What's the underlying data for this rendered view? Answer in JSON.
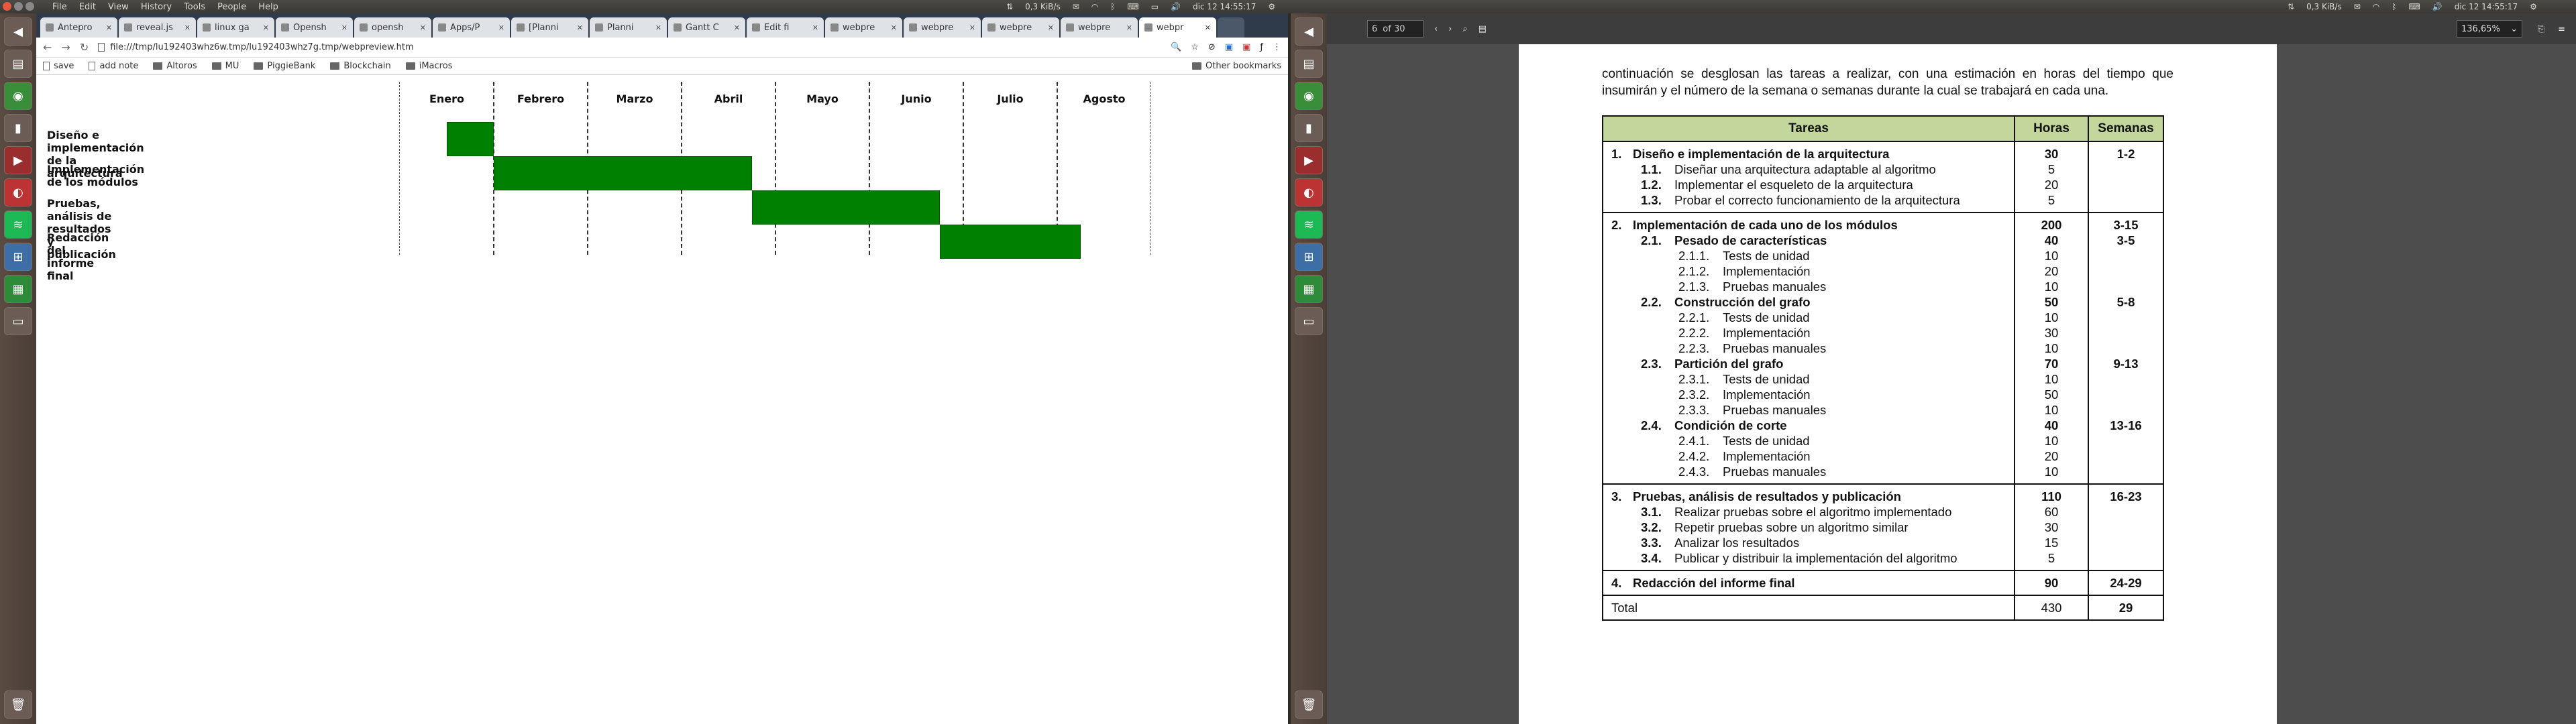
{
  "topbar": {
    "menus": [
      "File",
      "Edit",
      "View",
      "History",
      "Tools",
      "People",
      "Help"
    ],
    "left_status": {
      "network": "0,3 KiB/s",
      "time": "dic 12    14:55:17"
    },
    "right_status": {
      "network": "0,3 KiB/s",
      "time": "dic 12    14:55:17"
    }
  },
  "browser": {
    "tabs": [
      "Antepro",
      "reveal.js",
      "linux ga",
      "Opensh",
      "opensh",
      "Apps/P",
      "[Planni",
      "Planni",
      "Gantt C",
      "Edit fi",
      "webpre",
      "webpre",
      "webpre",
      "webpre",
      "webpr"
    ],
    "url": "file:///tmp/lu192403whz6w.tmp/lu192403whz7g.tmp/webpreview.htm",
    "bookmarks": [
      "save",
      "add note",
      "Altoros",
      "MU",
      "PiggieBank",
      "Blockchain",
      "iMacros"
    ],
    "other_bookmarks": "Other bookmarks"
  },
  "gantt": {
    "months": [
      "Enero",
      "Febrero",
      "Marzo",
      "Abril",
      "Mayo",
      "Junio",
      "Julio",
      "Agosto"
    ],
    "rows": [
      {
        "label": "Diseño e implementación de la arquitectura",
        "start": 0.5,
        "end": 1.0
      },
      {
        "label": "Implementación de los módulos",
        "start": 1.0,
        "end": 3.75
      },
      {
        "label": "Pruebas, análisis de resultados y publicación",
        "start": 3.75,
        "end": 5.75
      },
      {
        "label": "Redacción del informe final",
        "start": 5.75,
        "end": 7.25
      }
    ],
    "bar_color": "#008000"
  },
  "pdf": {
    "page_input": "6",
    "page_total": "of 30",
    "zoom": "136,65%",
    "intro": "continuación se desglosan las tareas a realizar, con una estimación en horas del tiempo que insumirán y el número de la semana o semanas durante la cual se trabajará en cada una.",
    "headers": {
      "tasks": "Tareas",
      "hours": "Horas",
      "weeks": "Semanas"
    },
    "header_color": "#c3d69b",
    "blocks": [
      {
        "lines": [
          {
            "lvl": 0,
            "num": "1.",
            "text": "Diseño e implementación de la arquitectura",
            "hours": "30",
            "weeks": "1-2",
            "bold": true
          },
          {
            "lvl": 1,
            "num": "1.1.",
            "text": "Diseñar una arquitectura adaptable al algoritmo",
            "hours": "5",
            "weeks": ""
          },
          {
            "lvl": 1,
            "num": "1.2.",
            "text": "Implementar el esqueleto de la arquitectura",
            "hours": "20",
            "weeks": ""
          },
          {
            "lvl": 1,
            "num": "1.3.",
            "text": "Probar el correcto funcionamiento de la arquitectura",
            "hours": "5",
            "weeks": ""
          }
        ]
      },
      {
        "lines": [
          {
            "lvl": 0,
            "num": "2.",
            "text": "Implementación de cada uno de los módulos",
            "hours": "200",
            "weeks": "3-15",
            "bold": true
          },
          {
            "lvl": 1,
            "num": "2.1.",
            "text": "Pesado de características",
            "hours": "40",
            "weeks": "3-5",
            "bold": true
          },
          {
            "lvl": 2,
            "num": "2.1.1.",
            "text": "Tests de unidad",
            "hours": "10",
            "weeks": ""
          },
          {
            "lvl": 2,
            "num": "2.1.2.",
            "text": "Implementación",
            "hours": "20",
            "weeks": ""
          },
          {
            "lvl": 2,
            "num": "2.1.3.",
            "text": "Pruebas manuales",
            "hours": "10",
            "weeks": ""
          },
          {
            "lvl": 1,
            "num": "2.2.",
            "text": "Construcción del grafo",
            "hours": "50",
            "weeks": "5-8",
            "bold": true
          },
          {
            "lvl": 2,
            "num": "2.2.1.",
            "text": "Tests de unidad",
            "hours": "10",
            "weeks": ""
          },
          {
            "lvl": 2,
            "num": "2.2.2.",
            "text": "Implementación",
            "hours": "30",
            "weeks": ""
          },
          {
            "lvl": 2,
            "num": "2.2.3.",
            "text": "Pruebas manuales",
            "hours": "10",
            "weeks": ""
          },
          {
            "lvl": 1,
            "num": "2.3.",
            "text": "Partición del grafo",
            "hours": "70",
            "weeks": "9-13",
            "bold": true
          },
          {
            "lvl": 2,
            "num": "2.3.1.",
            "text": "Tests de unidad",
            "hours": "10",
            "weeks": ""
          },
          {
            "lvl": 2,
            "num": "2.3.2.",
            "text": "Implementación",
            "hours": "50",
            "weeks": ""
          },
          {
            "lvl": 2,
            "num": "2.3.3.",
            "text": "Pruebas manuales",
            "hours": "10",
            "weeks": ""
          },
          {
            "lvl": 1,
            "num": "2.4.",
            "text": "Condición de corte",
            "hours": "40",
            "weeks": "13-16",
            "bold": true
          },
          {
            "lvl": 2,
            "num": "2.4.1.",
            "text": "Tests de unidad",
            "hours": "10",
            "weeks": ""
          },
          {
            "lvl": 2,
            "num": "2.4.2.",
            "text": "Implementación",
            "hours": "20",
            "weeks": ""
          },
          {
            "lvl": 2,
            "num": "2.4.3.",
            "text": "Pruebas manuales",
            "hours": "10",
            "weeks": ""
          }
        ]
      },
      {
        "lines": [
          {
            "lvl": 0,
            "num": "3.",
            "text": "Pruebas, análisis de resultados y publicación",
            "hours": "110",
            "weeks": "16-23",
            "bold": true
          },
          {
            "lvl": 1,
            "num": "3.1.",
            "text": "Realizar pruebas sobre el algoritmo implementado",
            "hours": "60",
            "weeks": ""
          },
          {
            "lvl": 1,
            "num": "3.2.",
            "text": "Repetir pruebas sobre un algoritmo similar",
            "hours": "30",
            "weeks": ""
          },
          {
            "lvl": 1,
            "num": "3.3.",
            "text": "Analizar los resultados",
            "hours": "15",
            "weeks": ""
          },
          {
            "lvl": 1,
            "num": "3.4.",
            "text": "Publicar y distribuir la implementación del algoritmo",
            "hours": "5",
            "weeks": ""
          }
        ]
      },
      {
        "lines": [
          {
            "lvl": 0,
            "num": "4.",
            "text": "Redacción del informe final",
            "hours": "90",
            "weeks": "24-29",
            "bold": true
          }
        ]
      },
      {
        "lines": [
          {
            "lvl": -1,
            "num": "",
            "text": "Total",
            "hours": "430",
            "weeks": "29",
            "bold": false
          }
        ]
      }
    ]
  }
}
